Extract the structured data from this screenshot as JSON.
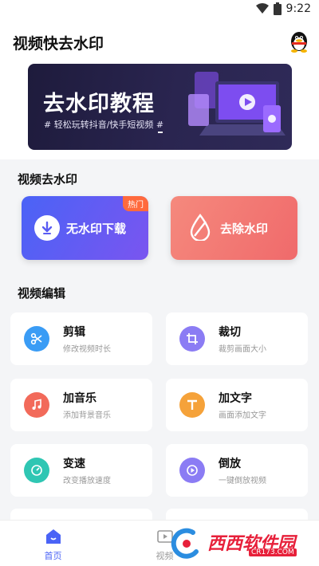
{
  "status_bar": {
    "time": "9:22"
  },
  "app": {
    "title": "视频快去水印"
  },
  "banner": {
    "title": "去水印教程",
    "subtitle": "# 轻松玩转抖音/快手短视频 #"
  },
  "watermark_section": {
    "title": "视频去水印",
    "no_watermark_download": {
      "label": "无水印下载",
      "badge": "热门"
    },
    "remove_watermark": {
      "label": "去除水印"
    }
  },
  "edit_section": {
    "title": "视频编辑",
    "items": [
      {
        "title": "剪辑",
        "subtitle": "修改视频时长",
        "icon": "scissors-icon",
        "color": "#3a9cf5"
      },
      {
        "title": "裁切",
        "subtitle": "裁剪画面大小",
        "icon": "crop-icon",
        "color": "#8b7cf4"
      },
      {
        "title": "加音乐",
        "subtitle": "添加背景音乐",
        "icon": "music-note-icon",
        "color": "#f26a5a"
      },
      {
        "title": "加文字",
        "subtitle": "画面添加文字",
        "icon": "text-icon",
        "color": "#f5a23a"
      },
      {
        "title": "变速",
        "subtitle": "改变播放速度",
        "icon": "speedometer-icon",
        "color": "#2fc6b3"
      },
      {
        "title": "倒放",
        "subtitle": "一键倒放视频",
        "icon": "reverse-play-icon",
        "color": "#8b7cf4"
      }
    ]
  },
  "tab_bar": {
    "tabs": [
      {
        "label": "首页",
        "active": true
      },
      {
        "label": "视频",
        "active": false
      }
    ]
  },
  "watermark_logo": {
    "text": "西西软件园",
    "sub": "CR173.COM"
  },
  "colors": {
    "accent": "#4a63f6",
    "hot": "#ff6a3d"
  }
}
